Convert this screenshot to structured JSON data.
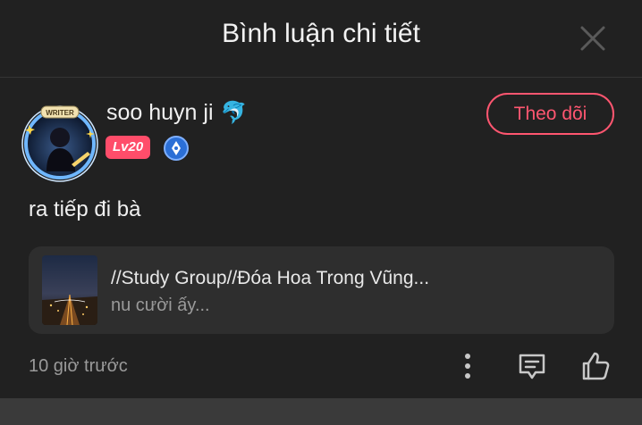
{
  "header": {
    "title": "Bình luận chi tiết",
    "close_icon": "close-icon"
  },
  "comment": {
    "username": "soo huyn ji",
    "username_emoji": "🐬",
    "avatar_frame_text": "WRITER",
    "level_badge": "Lv20",
    "writer_badge_icon": "pen-nib-icon",
    "follow_label": "Theo dõi",
    "text": "ra tiếp đi bà",
    "linked_story": {
      "title": "//Study Group//Đóa Hoa Trong Vũng...",
      "subtitle": "nu cười ấy..."
    },
    "timestamp": "10 giờ trước",
    "actions": {
      "more_icon": "more-vertical-icon",
      "reply_icon": "comment-icon",
      "like_icon": "thumbs-up-icon"
    }
  },
  "colors": {
    "background": "#212121",
    "accent": "#ff5670",
    "card": "#2e2e2e",
    "muted_text": "#9a9a9a"
  }
}
